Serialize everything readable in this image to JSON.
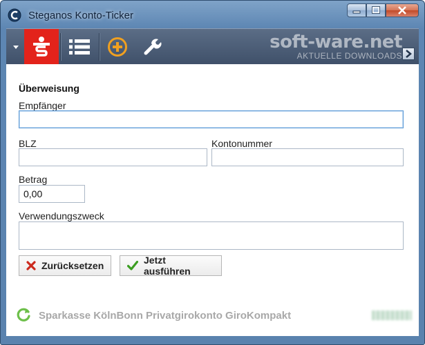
{
  "window": {
    "title": "Steganos Konto-Ticker"
  },
  "watermark": {
    "logo": "soft-ware.net",
    "subtitle": "AKTUELLE DOWNLOADS"
  },
  "toolbar": {
    "items": [
      {
        "name": "dropdown",
        "icon": "caret-down-icon"
      },
      {
        "name": "sparkasse",
        "icon": "sparkasse-logo-icon",
        "accent": "#e3231b"
      },
      {
        "name": "list",
        "icon": "list-icon"
      },
      {
        "name": "add",
        "icon": "add-circle-icon",
        "accent": "#f0a020"
      },
      {
        "name": "tools",
        "icon": "wrench-icon"
      }
    ],
    "next_icon": "chevron-right-icon"
  },
  "form": {
    "section_title": "Überweisung",
    "recipient_label": "Empfänger",
    "recipient_value": "",
    "blz_label": "BLZ",
    "blz_value": "",
    "account_label": "Kontonummer",
    "account_value": "",
    "amount_label": "Betrag",
    "amount_value": "0,00",
    "purpose_label": "Verwendungszweck",
    "purpose_value": ""
  },
  "actions": {
    "reset_label": "Zurücksetzen",
    "reset_icon": "x-icon",
    "execute_label": "Jetzt ausführen",
    "execute_icon": "checkmark-icon"
  },
  "status": {
    "icon": "refresh-icon",
    "account_text": "Sparkasse KölnBonn Privatgirokonto GiroKompakt"
  },
  "colors": {
    "sparkasse_red": "#e3231b",
    "refresh_green": "#6dbf4a",
    "reset_red": "#cc2a1e",
    "execute_green": "#3c9e22"
  }
}
